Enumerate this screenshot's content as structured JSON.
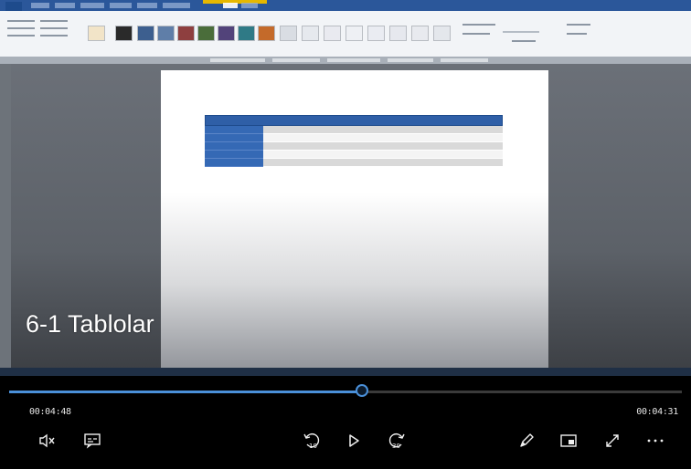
{
  "video": {
    "title": "6-1 Tablolar",
    "progress_fraction": 0.525
  },
  "player": {
    "elapsed": "00:04:48",
    "remaining": "00:04:31"
  },
  "controls": {
    "mute_icon": "volume-muted-icon",
    "captions_icon": "captions-icon",
    "skip_back": {
      "icon": "skip-back-10-icon",
      "label": "10"
    },
    "play_icon": "play-icon",
    "skip_forward": {
      "icon": "skip-forward-30-icon",
      "label": "30"
    },
    "edit_icon": "pencil-icon",
    "miniview_icon": "mini-view-icon",
    "fullscreen_icon": "expand-icon",
    "more_icon": "more-icon"
  },
  "colors": {
    "accent": "#4a90d9",
    "ribbon_blue": "#2b579a",
    "table_header": "#2f5fa7"
  }
}
